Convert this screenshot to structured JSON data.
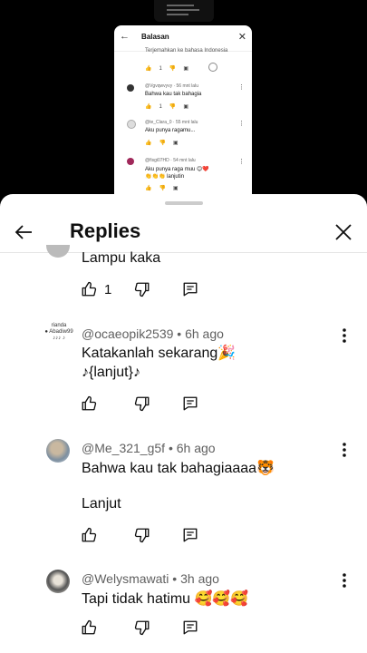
{
  "embedded": {
    "title": "Balasan",
    "translate": "Terjemahkan ke bahasa Indonesia",
    "count1": "1",
    "c1_meta": "@Vgvqwvyvy · 56 mnt lalu",
    "c1_text": "Bahwa kau tak bahagia",
    "c1_count": "1",
    "c2_meta": "@te_Clara_0 · 55 mnt lalu",
    "c2_text": "Aku punya ragamu...",
    "c3_meta": "@fisgi07HD · 54 mnt lalu",
    "c3_text": "Aku punya raga muu 😊❤️",
    "c3_text2": "👏👏👏 lanjutin"
  },
  "header": {
    "title": "Replies"
  },
  "comments": [
    {
      "text": "Lampu kaka",
      "likes": "1"
    },
    {
      "author": "@ocaeopik2539",
      "time": "6h ago",
      "line1": "Katakanlah sekarang🎉",
      "line2": "♪{lanjut}♪",
      "avatar_text": "rianda\n Abadiw99\n ♪♪♪ ♪"
    },
    {
      "author": "@Me_321_g5f",
      "time": "6h ago",
      "line1": "Bahwa kau tak bahagiaaaa🐯",
      "line2": "Lanjut"
    },
    {
      "author": "@Welysmawati",
      "time": "3h ago",
      "line1": "Tapi tidak hatimu 🥰🥰🥰"
    }
  ]
}
